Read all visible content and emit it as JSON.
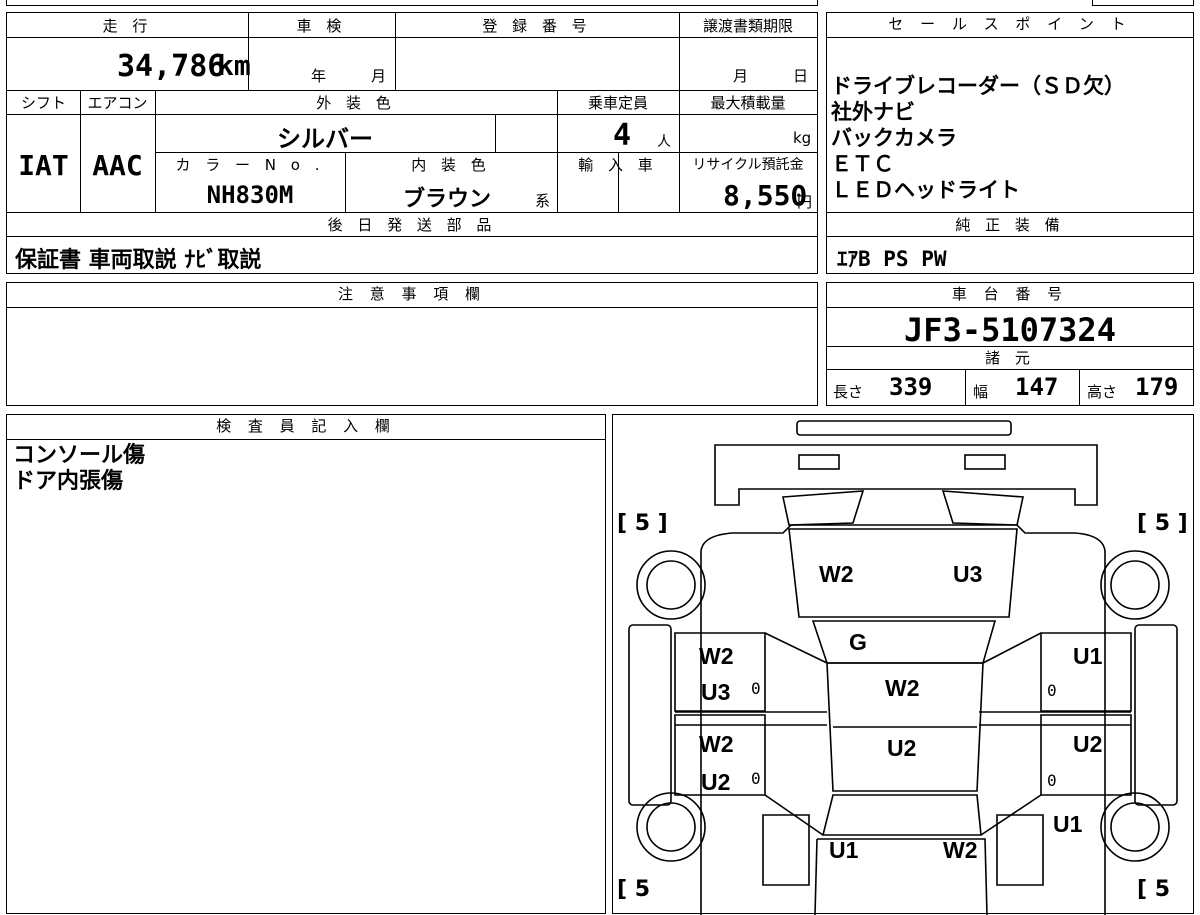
{
  "vehicle": {
    "mileage_label": "走 行",
    "mileage_value": "34,786",
    "mileage_unit": "km",
    "inspection_label": "車 検",
    "year_unit": "年",
    "month_unit": "月",
    "registration_label": "登 録 番 号",
    "deadline_label": "譲渡書類期限",
    "deadline_month": "月",
    "deadline_day": "日",
    "shift_label": "シフト",
    "shift_value": "IAT",
    "ac_label": "エアコン",
    "ac_value": "AAC",
    "exterior_label": "外 装 色",
    "exterior_value": "シルバー",
    "capacity_label": "乗車定員",
    "capacity_value": "4",
    "capacity_unit": "人",
    "load_label": "最大積載量",
    "load_unit": "kg",
    "color_no_label": "カ ラ ー N o .",
    "color_no_value": "NH830M",
    "interior_label": "内 装 色",
    "interior_value": "ブラウン",
    "interior_suffix": "系",
    "import_label": "輸 入 車",
    "recycle_label": "リサイクル預託金",
    "recycle_value": "8,550",
    "recycle_unit": "円",
    "later_parts_label": "後 日 発 送 部 品",
    "later_parts_value": "保証書 車両取説 ﾅﾋﾞ取説"
  },
  "sales": {
    "title": "セ ー ル ス ポ イ ン ト",
    "points": [
      "ドライブレコーダー（ＳＤ欠）",
      "社外ナビ",
      "バックカメラ",
      "ＥＴＣ",
      "ＬＥＤヘッドライト"
    ],
    "equipment_label": "純 正 装 備",
    "equipment_value": "ｴｱB PS PW"
  },
  "notes": {
    "title": "注 意 事 項 欄",
    "body": ""
  },
  "chassis": {
    "label": "車 台 番 号",
    "number": "JF3-5107324",
    "specs_label": "諸 元",
    "length_label": "長さ",
    "length_value": "339",
    "width_label": "幅",
    "width_value": "147",
    "height_label": "高さ",
    "height_value": "179"
  },
  "inspector": {
    "title": "検 査 員 記 入 欄",
    "lines": [
      "コンソール傷",
      "ドア内張傷"
    ]
  },
  "diagram": {
    "tires": [
      "[ 5 ]",
      "[ 5 ]",
      "[ 5",
      "[ 5"
    ],
    "marks": {
      "hood_left": "W2",
      "hood_right": "U3",
      "windshield": "G",
      "roof_top": "W2",
      "roof_bottom": "U2",
      "left_front_1": "W2",
      "left_front_2": "U3",
      "left_rear_1": "W2",
      "left_rear_2": "U2",
      "right_front": "U1",
      "right_rear": "U2",
      "right_quarter": "U1",
      "rear_left": "U1",
      "rear_right": "W2"
    },
    "zero": "0"
  }
}
